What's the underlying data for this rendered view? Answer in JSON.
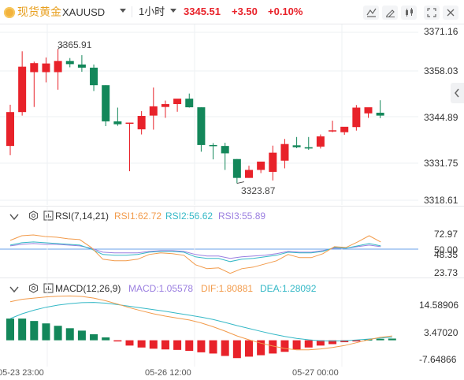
{
  "header": {
    "instrument_name": "现货黄金",
    "symbol": "XAUUSD",
    "period": "1小时",
    "price": "3345.51",
    "change": "+3.50",
    "change_pct": "+0.10%",
    "tools": [
      "line-chart-icon",
      "draw-icon",
      "candlestick-type-icon",
      "fullscreen-icon",
      "close-icon"
    ]
  },
  "colors": {
    "up": "#e8222a",
    "down": "#13875a",
    "green_text": "#0a8f5a",
    "rsi1": "#f29b4b",
    "rsi2": "#34b8c6",
    "rsi3": "#9b7fe0",
    "macd": "#9b7fe0",
    "dif": "#f29b4b",
    "dea": "#34b8c6"
  },
  "price_axis": [
    "3371.16",
    "3358.03",
    "3344.89",
    "3331.75",
    "3318.61"
  ],
  "annotations": {
    "high": "3365.91",
    "low": "3323.87"
  },
  "rsi": {
    "title": "RSI(7,14,21)",
    "rsi1": "RSI1:62.72",
    "rsi2": "RSI2:56.62",
    "rsi3": "RSI3:55.89",
    "axis": [
      "72.97",
      "50.00",
      "48.35",
      "23.73"
    ]
  },
  "macd": {
    "title": "MACD(12,26,9)",
    "macd": "MACD:1.05578",
    "dif": "DIF:1.80881",
    "dea": "DEA:1.28092",
    "axis": [
      "14.58906",
      "3.47020",
      "-7.64866"
    ]
  },
  "time_axis": [
    "05-23 23:00",
    "05-26 12:00",
    "05-27 00:00"
  ],
  "chart_data": {
    "type": "candlestick",
    "ylim": [
      3316,
      3372
    ],
    "candles": [
      {
        "o": 3335.6,
        "h": 3348.5,
        "l": 3332.7,
        "c": 3346.2
      },
      {
        "o": 3346.2,
        "h": 3365.2,
        "l": 3345.1,
        "c": 3360.4
      },
      {
        "o": 3358.7,
        "h": 3362.0,
        "l": 3347.8,
        "c": 3361.5
      },
      {
        "o": 3358.7,
        "h": 3363.3,
        "l": 3355.5,
        "c": 3361.4
      },
      {
        "o": 3358.7,
        "h": 3365.9,
        "l": 3353.2,
        "c": 3362.2
      },
      {
        "o": 3362.2,
        "h": 3363.1,
        "l": 3360.2,
        "c": 3361.2
      },
      {
        "o": 3361.1,
        "h": 3364.0,
        "l": 3358.8,
        "c": 3360.1
      },
      {
        "o": 3360.1,
        "h": 3361.1,
        "l": 3352.8,
        "c": 3354.6
      },
      {
        "o": 3354.6,
        "h": 3354.6,
        "l": 3341.8,
        "c": 3343.3
      },
      {
        "o": 3343.3,
        "h": 3347.6,
        "l": 3341.9,
        "c": 3342.4
      },
      {
        "o": 3342.9,
        "h": 3342.9,
        "l": 3327.7,
        "c": 3342.9
      },
      {
        "o": 3340.8,
        "h": 3346.5,
        "l": 3339.2,
        "c": 3345.0
      },
      {
        "o": 3345.1,
        "h": 3353.9,
        "l": 3340.7,
        "c": 3348.0
      },
      {
        "o": 3347.8,
        "h": 3349.8,
        "l": 3344.4,
        "c": 3348.7
      },
      {
        "o": 3348.7,
        "h": 3350.1,
        "l": 3346.3,
        "c": 3350.4
      },
      {
        "o": 3350.4,
        "h": 3352.0,
        "l": 3347.6,
        "c": 3347.7
      },
      {
        "o": 3347.7,
        "h": 3347.7,
        "l": 3333.8,
        "c": 3335.9
      },
      {
        "o": 3335.9,
        "h": 3336.5,
        "l": 3331.4,
        "c": 3335.6
      },
      {
        "o": 3335.6,
        "h": 3336.6,
        "l": 3328.1,
        "c": 3333.3
      },
      {
        "o": 3331.5,
        "h": 3331.5,
        "l": 3323.9,
        "c": 3325.6
      },
      {
        "o": 3325.6,
        "h": 3329.4,
        "l": 3325.6,
        "c": 3328.1
      },
      {
        "o": 3328.1,
        "h": 3330.7,
        "l": 3327.1,
        "c": 3330.7
      },
      {
        "o": 3327.5,
        "h": 3335.7,
        "l": 3324.8,
        "c": 3333.5
      },
      {
        "o": 3331.0,
        "h": 3337.8,
        "l": 3328.6,
        "c": 3336.2
      },
      {
        "o": 3335.8,
        "h": 3338.4,
        "l": 3334.9,
        "c": 3335.2
      },
      {
        "o": 3335.2,
        "h": 3338.4,
        "l": 3334.4,
        "c": 3334.8
      },
      {
        "o": 3335.4,
        "h": 3339.2,
        "l": 3334.8,
        "c": 3338.6
      },
      {
        "o": 3340.4,
        "h": 3343.5,
        "l": 3339.9,
        "c": 3340.5
      },
      {
        "o": 3339.9,
        "h": 3339.9,
        "l": 3339.1,
        "c": 3341.6
      },
      {
        "o": 3341.5,
        "h": 3348.4,
        "l": 3340.4,
        "c": 3347.6
      },
      {
        "o": 3345.8,
        "h": 3347.6,
        "l": 3344.4,
        "c": 3347.7
      },
      {
        "o": 3346.0,
        "h": 3349.9,
        "l": 3344.3,
        "c": 3345.1
      }
    ]
  }
}
